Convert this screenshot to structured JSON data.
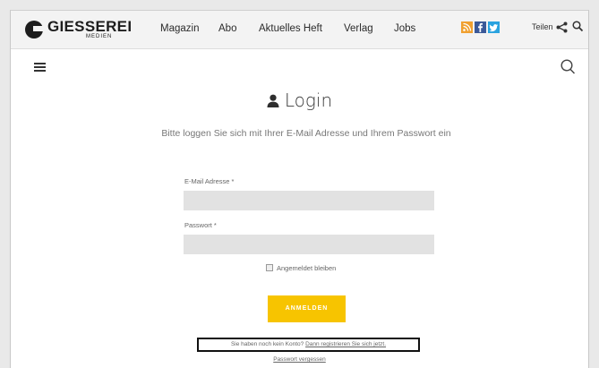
{
  "header": {
    "logo_text": "GIESSEREI",
    "logo_sub": "MEDIEN",
    "nav": [
      "Magazin",
      "Abo",
      "Aktuelles Heft",
      "Verlag",
      "Jobs"
    ],
    "share_label": "Teilen",
    "colors": {
      "rss": "#f0a030",
      "facebook": "#3b5998",
      "twitter": "#2aa3df"
    }
  },
  "page": {
    "title": "Login",
    "subtitle": "Bitte loggen Sie sich mit Ihrer E-Mail Adresse und Ihrem Passwort ein",
    "email_label": "E-Mail Adresse *",
    "email_value": "",
    "password_label": "Passwort *",
    "password_value": "",
    "remember_label": "Angemeldet bleiben",
    "login_button": "ANMELDEN",
    "register_text": "Sie haben noch kein Konto?",
    "register_link": "Dann registrieren Sie sich jetzt.",
    "forgot_link": "Passwort vergessen"
  },
  "accent": "#f7c400"
}
